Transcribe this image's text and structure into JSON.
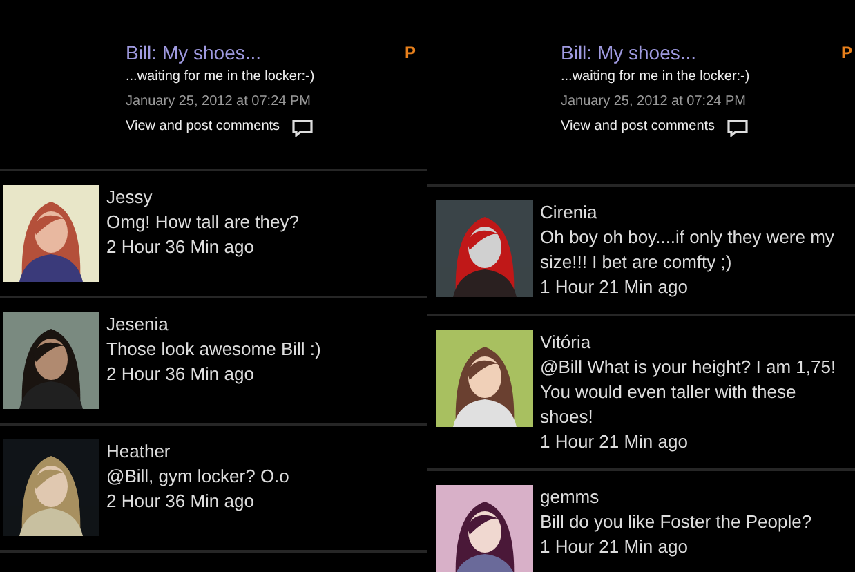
{
  "panels": [
    {
      "post": {
        "title": "Bill: My shoes...",
        "badge": "P",
        "description": "...waiting for me in the locker:-)",
        "date": "January 25, 2012 at 07:24 PM",
        "comments_link": "View and post comments"
      },
      "comments": [
        {
          "author": "Jessy",
          "text": "Omg! How tall are they?",
          "time": "2 Hour 36 Min ago"
        },
        {
          "author": "Jesenia",
          "text": "Those look awesome Bill :)",
          "time": "2 Hour 36 Min ago"
        },
        {
          "author": "Heather",
          "text": "@Bill, gym locker? O.o",
          "time": "2 Hour 36 Min ago"
        }
      ]
    },
    {
      "post": {
        "title": "Bill: My shoes...",
        "badge": "P",
        "description": "...waiting for me in the locker:-)",
        "date": "January 25, 2012 at 07:24 PM",
        "comments_link": "View and post comments"
      },
      "comments": [
        {
          "author": "Cirenia",
          "text": "Oh boy  oh boy....if only they were my size!!!  I bet are comfty ;)",
          "time": "1 Hour 21 Min ago"
        },
        {
          "author": "Vitória",
          "text": "@Bill What is your height? I am 1,75! You would even taller with these shoes!",
          "time": "1 Hour 21 Min ago"
        },
        {
          "author": "gemms",
          "text": "Bill do you like Foster the People?",
          "time": "1 Hour 21 Min ago"
        }
      ]
    }
  ]
}
